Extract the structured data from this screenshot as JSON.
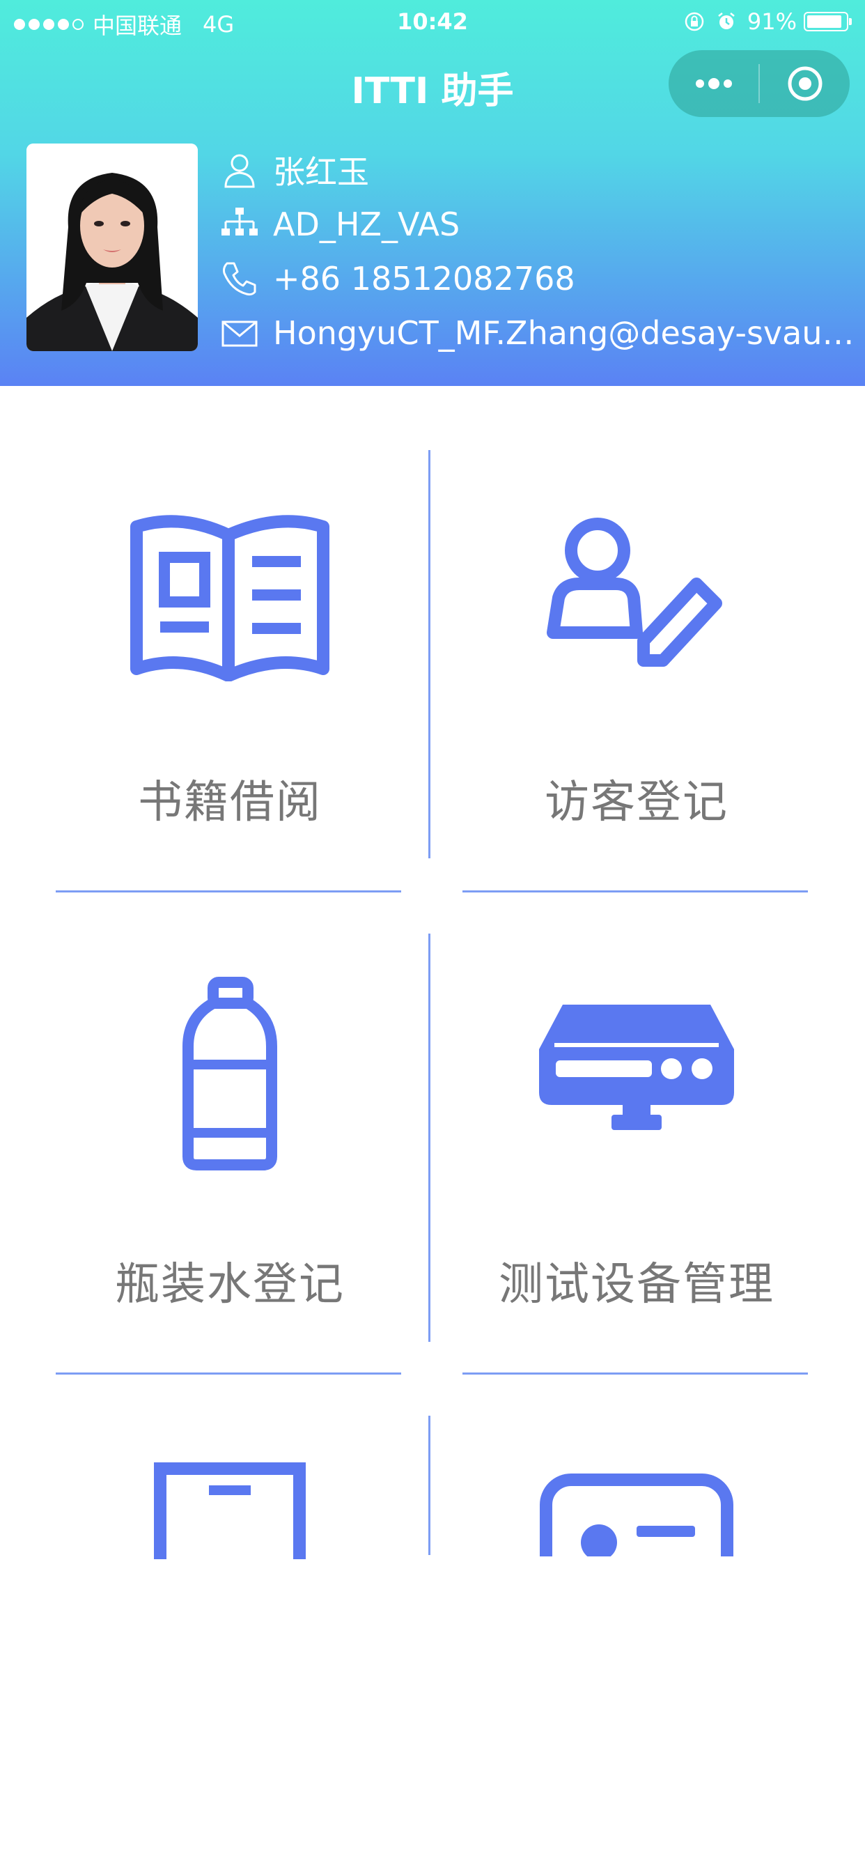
{
  "status_bar": {
    "carrier": "中国联通",
    "network": "4G",
    "time": "10:42",
    "battery_text": "91%",
    "battery_level": 0.91,
    "signal_bars_filled": 4,
    "signal_bars_total": 5
  },
  "nav": {
    "title": "ITTI 助手",
    "more_icon": "more-dots-icon",
    "close_icon": "target-circle-icon"
  },
  "profile": {
    "name": "张红玉",
    "department": "AD_HZ_VAS",
    "phone": "+86 18512082768",
    "email": "HongyuCT_MF.Zhang@desay-svaut…",
    "icons": {
      "name": "user-icon",
      "department": "org-chart-icon",
      "phone": "phone-icon",
      "email": "mail-icon"
    }
  },
  "menu": {
    "items": [
      {
        "label": "书籍借阅",
        "icon": "book-icon"
      },
      {
        "label": "访客登记",
        "icon": "visitor-edit-icon"
      },
      {
        "label": "瓶装水登记",
        "icon": "water-bottle-icon"
      },
      {
        "label": "测试设备管理",
        "icon": "test-device-icon"
      },
      {
        "label": "",
        "icon": "cabinet-icon"
      },
      {
        "label": "",
        "icon": "id-card-icon"
      }
    ]
  },
  "colors": {
    "accent": "#5a78f0",
    "header_top": "#50ecdc",
    "header_bottom": "#5a82f4",
    "label_text": "#777777",
    "divider": "#7d9df4"
  }
}
